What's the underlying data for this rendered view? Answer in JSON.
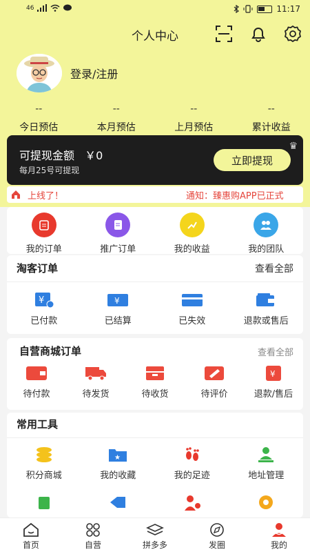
{
  "status": {
    "signal": "46",
    "time": "11:17"
  },
  "header": {
    "title": "个人中心",
    "scan_icon": "scan-icon",
    "bell_icon": "bell-icon",
    "settings_icon": "gear-icon"
  },
  "profile": {
    "login_label": "登录/注册"
  },
  "stats": [
    {
      "value": "--",
      "label": "今日预估"
    },
    {
      "value": "--",
      "label": "本月预估"
    },
    {
      "value": "--",
      "label": "上月预估"
    },
    {
      "value": "--",
      "label": "累计收益"
    }
  ],
  "wallet": {
    "label": "可提现金额",
    "amount": "￥0",
    "sub": "每月25号可提现",
    "button": "立即提现"
  },
  "notice": {
    "text_left": "上线了！",
    "text_right": "通知：臻惠购APP已正式"
  },
  "orders_row": [
    {
      "label": "我的订单",
      "color": "#e8392d"
    },
    {
      "label": "推广订单",
      "color": "#8a57e8"
    },
    {
      "label": "我的收益",
      "color": "#f4d51c"
    },
    {
      "label": "我的团队",
      "color": "#3aa6e8"
    }
  ],
  "taoke": {
    "title": "淘客订单",
    "more": "查看全部",
    "items": [
      {
        "label": "已付款"
      },
      {
        "label": "已结算"
      },
      {
        "label": "已失效"
      },
      {
        "label": "退款或售后"
      }
    ],
    "color": "#2f7fe0"
  },
  "self_mall": {
    "title": "自营商城订单",
    "more": "查看全部",
    "items": [
      {
        "label": "待付款"
      },
      {
        "label": "待发货"
      },
      {
        "label": "待收货"
      },
      {
        "label": "待评价"
      },
      {
        "label": "退款/售后"
      }
    ],
    "color": "#ec4a3c"
  },
  "tools": {
    "title": "常用工具",
    "items": [
      {
        "label": "积分商城"
      },
      {
        "label": "我的收藏"
      },
      {
        "label": "我的足迹"
      },
      {
        "label": "地址管理"
      }
    ]
  },
  "tabbar": [
    {
      "label": "首页",
      "icon": "home-icon"
    },
    {
      "label": "自营",
      "icon": "grid-icon"
    },
    {
      "label": "拼多多",
      "icon": "layers-icon"
    },
    {
      "label": "发圈",
      "icon": "compass-icon"
    },
    {
      "label": "我的",
      "icon": "user-icon"
    }
  ]
}
